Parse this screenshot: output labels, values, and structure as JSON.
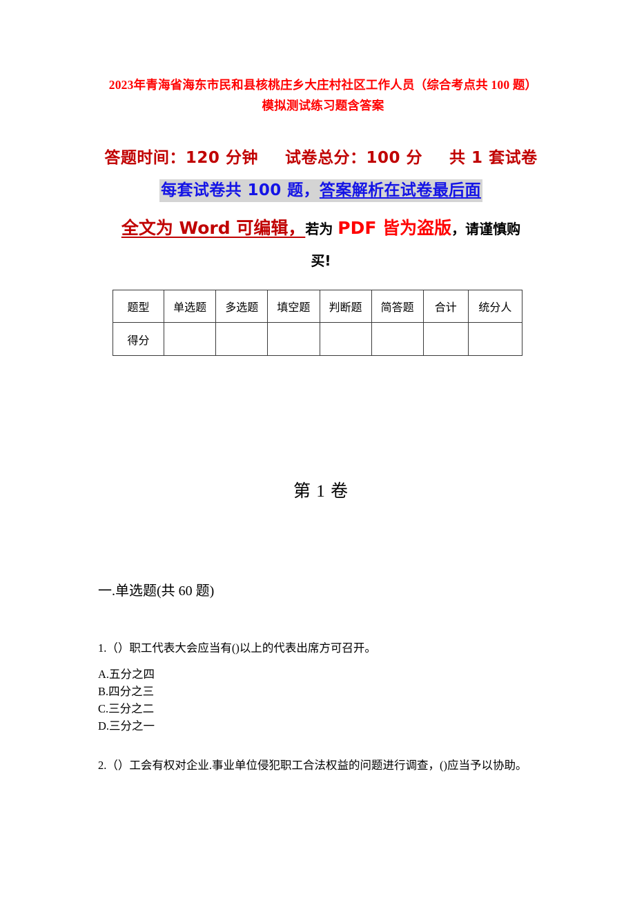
{
  "document": {
    "title": "2023年青海省海东市民和县核桃庄乡大庄村社区工作人员（综合考点共 100 题）模拟测试练习题含答案",
    "colors": {
      "title_red": "#FF0000",
      "dark_red": "#C00000",
      "bright_red": "#FF0000",
      "blue": "#1414E6",
      "highlight_gray": "#D4D4D4",
      "black": "#000000"
    }
  },
  "headline": {
    "line1": {
      "part_a": "答题时间：120 分钟",
      "part_b": "试卷总分：100 分",
      "part_c": "共 1 套试卷"
    },
    "line2": {
      "plain": "每套试卷共 100 题，",
      "underlined": "答案解析在试卷最后面"
    },
    "line3": {
      "seg_word": "全文为 Word 可编辑，",
      "seg_ruowei": "若为 ",
      "seg_pdf": "PDF 皆为盗版",
      "seg_tail": "，请谨慎购"
    },
    "line4": "买!"
  },
  "score_table": {
    "headers": [
      "题型",
      "单选题",
      "多选题",
      "填空题",
      "判断题",
      "简答题",
      "合计",
      "统分人"
    ],
    "row_label": "得分",
    "row_values": [
      "",
      "",
      "",
      "",
      "",
      "",
      ""
    ]
  },
  "volume_heading": "第 1 卷",
  "section": {
    "heading": "一.单选题(共 60 题)"
  },
  "questions": [
    {
      "number": "1.",
      "stem": "1.（）职工代表大会应当有()以上的代表出席方可召开。",
      "options": [
        "A.五分之四",
        "B.四分之三",
        "C.三分之二",
        "D.三分之一"
      ]
    },
    {
      "number": "2.",
      "stem": "2.（）工会有权对企业.事业单位侵犯职工合法权益的问题进行调查，()应当予以协助。",
      "options": []
    }
  ]
}
